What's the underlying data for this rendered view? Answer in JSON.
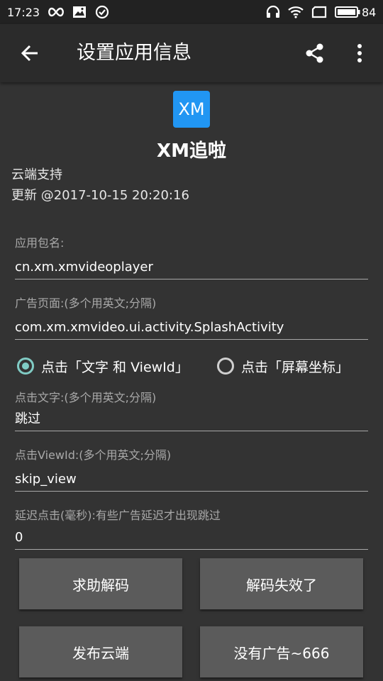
{
  "status_bar": {
    "time": "17:23",
    "battery": "84",
    "icons": [
      "infinity-icon",
      "image-icon",
      "check-circle-icon",
      "headset-icon",
      "wifi-icon",
      "sim-icon",
      "battery-icon"
    ]
  },
  "app_bar": {
    "title": "设置应用信息",
    "icons": [
      "back-arrow-icon",
      "share-icon",
      "more-vert-icon"
    ]
  },
  "app_info": {
    "logo_text": "XM",
    "logo_color": "#2196f3",
    "name": "XM追啦",
    "cloud_support": "云端支持",
    "updated": "更新 @2017-10-15 20:20:16"
  },
  "form": {
    "package_label": "应用包名:",
    "package_value": "cn.xm.xmvideoplayer",
    "ad_page_label": "广告页面:(多个用英文;分隔)",
    "ad_page_value": "com.xm.xmvideo.ui.activity.SplashActivity",
    "radio_text_viewid": "点击「文字 和 ViewId」",
    "radio_screen_coords": "点击「屏幕坐标」",
    "selected_radio": "text_viewid",
    "click_text_label": "点击文字:(多个用英文;分隔)",
    "click_text_value": "跳过",
    "click_viewid_label": "点击ViewId:(多个用英文;分隔)",
    "click_viewid_value": "skip_view",
    "delay_label": "延迟点击(毫秒):有些广告延迟才出现跳过",
    "delay_value": "0"
  },
  "buttons": {
    "help_decode": "求助解码",
    "decode_failed": "解码失效了",
    "publish_cloud": "发布云端",
    "no_ads": "没有广告~666"
  },
  "colors": {
    "accent": "#80cbc4",
    "background": "#333333",
    "app_bar": "#2b2b2b",
    "button": "#5b5b5b"
  }
}
